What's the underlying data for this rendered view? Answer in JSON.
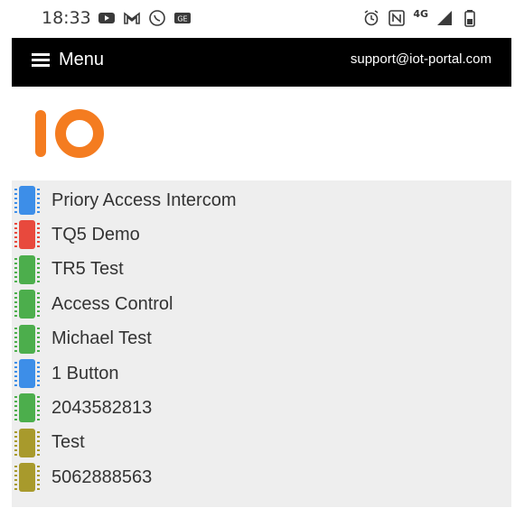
{
  "status_bar": {
    "time": "18:33",
    "left_icons": [
      "youtube-icon",
      "gmail-icon",
      "whatsapp-icon",
      "ge-icon"
    ],
    "right_icons": [
      "alarm-icon",
      "nfc-icon",
      "network-4g-icon",
      "signal-icon",
      "battery-icon"
    ],
    "network_label": "4G"
  },
  "nav": {
    "menu_label": "Menu",
    "support_email": "support@iot-portal.com"
  },
  "logo": {
    "text": "IO",
    "color": "#f47c20"
  },
  "devices": [
    {
      "name": "Priory Access Intercom",
      "color": "#3d8ee8"
    },
    {
      "name": "TQ5 Demo",
      "color": "#e8493d"
    },
    {
      "name": "TR5 Test",
      "color": "#4cae4c"
    },
    {
      "name": "Access Control",
      "color": "#4cae4c"
    },
    {
      "name": "Michael Test",
      "color": "#4cae4c"
    },
    {
      "name": "1 Button",
      "color": "#3d8ee8"
    },
    {
      "name": "2043582813",
      "color": "#4cae4c"
    },
    {
      "name": "Test",
      "color": "#a89a2c"
    },
    {
      "name": "5062888563",
      "color": "#a89a2c"
    }
  ]
}
